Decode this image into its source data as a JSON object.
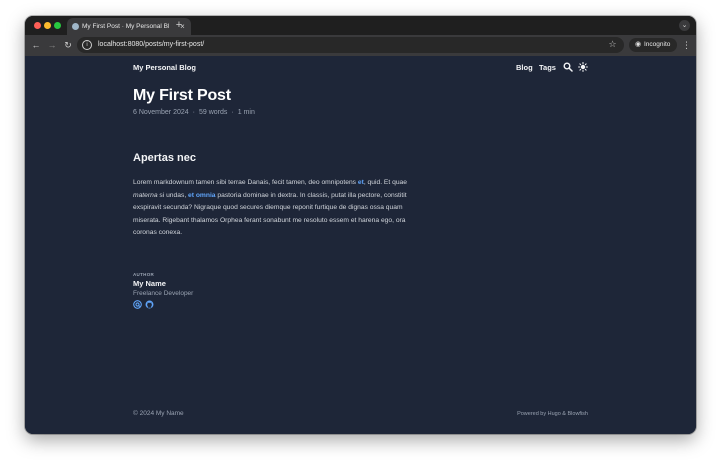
{
  "browser": {
    "tab_title": "My First Post · My Personal Bl",
    "tab_close": "×",
    "new_tab": "+",
    "tab_menu": "⌄",
    "url": "localhost:8080/posts/my-first-post/",
    "incognito_label": "Incognito"
  },
  "header": {
    "site_title": "My Personal Blog",
    "nav": [
      "Blog",
      "Tags"
    ]
  },
  "post": {
    "title": "My First Post",
    "date": "6 November 2024",
    "words": "59 words",
    "reading_time": "1 min",
    "separator": "·",
    "heading": "Apertas nec",
    "body": {
      "p1": "Lorem markdownum tamen sibi terrae Danais, fecit tamen, deo omnipotens ",
      "link1": "et",
      "p2": ", quid. Et quae ",
      "em1": "materna",
      "p3": " si undas, ",
      "link2": "et omnia",
      "p4": " pastoria dominae in dextra. In classis, putat illa pectore, constitit exspiravit secunda? Nigraque quod secures diemque reponit furtique de dignas ossa quam miserata. Rigebant thalamos Orphea ferant sonabunt me resoluto essem et harena ego, ora coronas conexa."
    }
  },
  "author": {
    "caption": "AUTHOR",
    "name": "My Name",
    "role": "Freelance Developer"
  },
  "footer": {
    "copyright": "© 2024 My Name",
    "powered": "Powered by Hugo & Blowfish"
  },
  "colors": {
    "page_bg": "#1e2638",
    "link": "#60a5fa",
    "accent_icons": "#60a5fa"
  }
}
